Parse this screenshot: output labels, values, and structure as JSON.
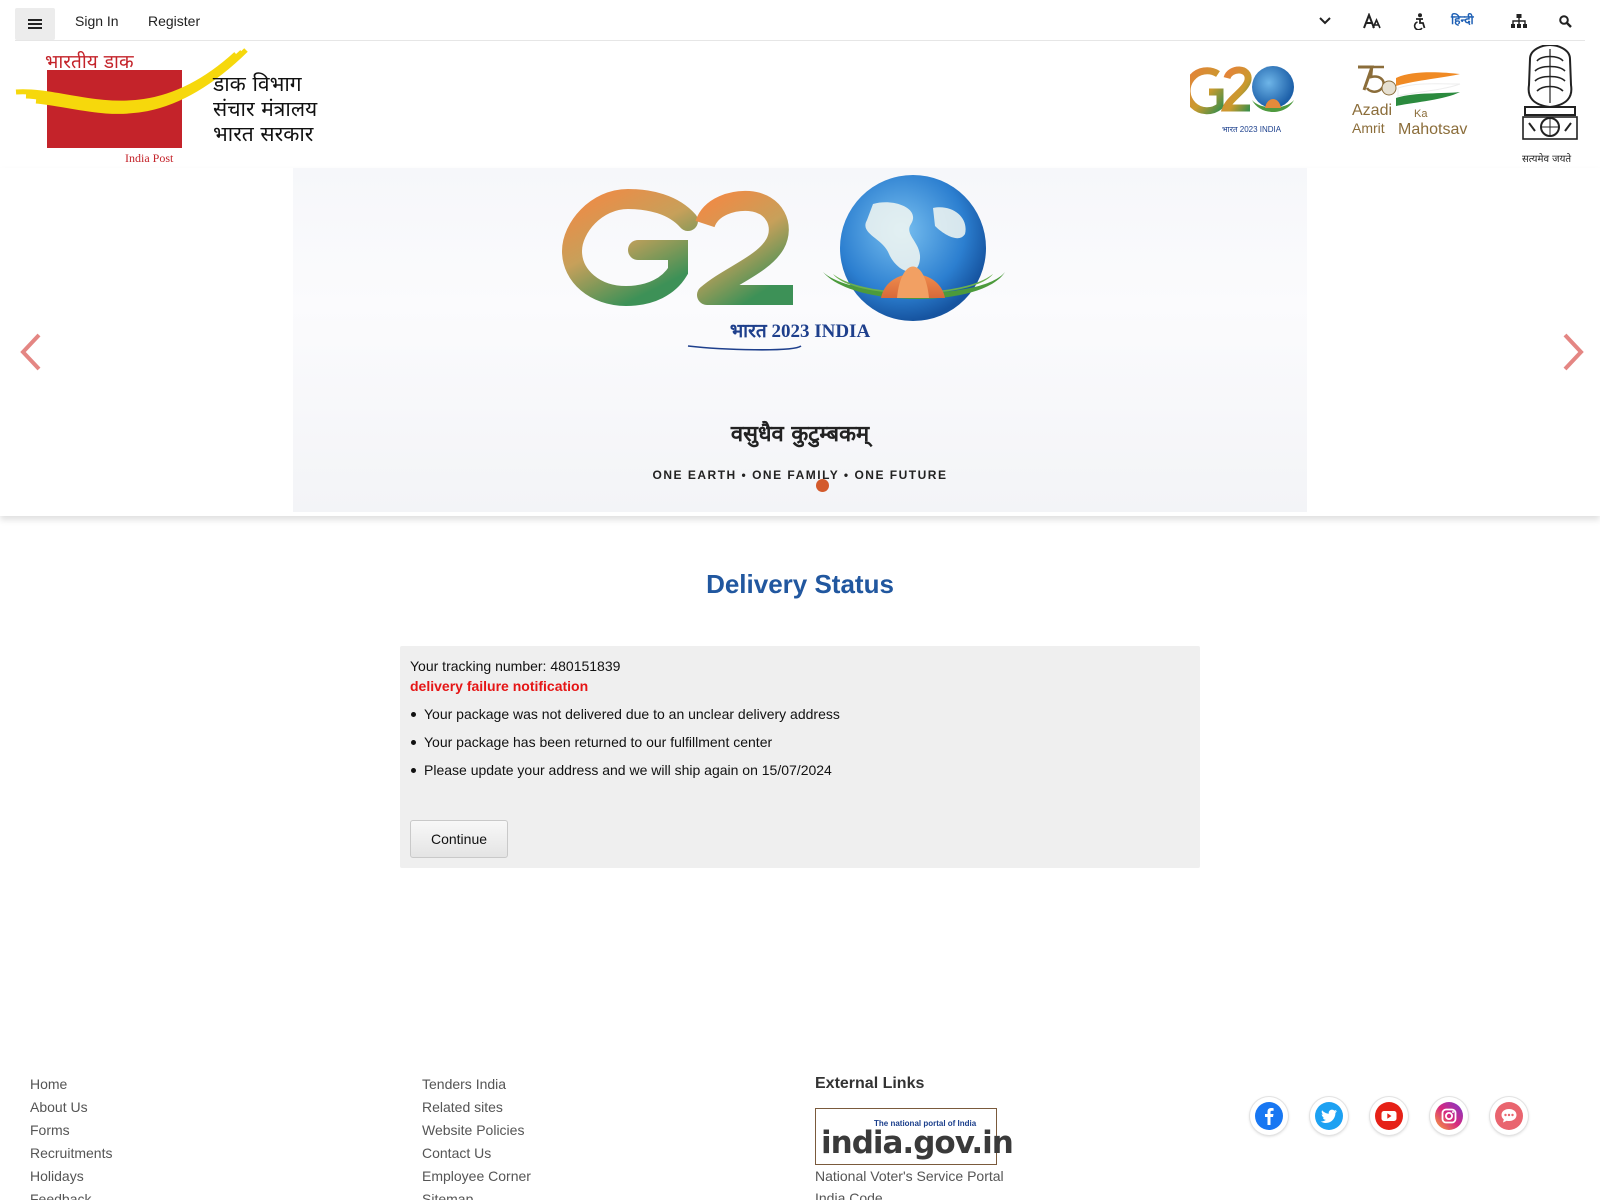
{
  "topbar": {
    "sign_in": "Sign In",
    "register": "Register",
    "hindi": "हिन्दी",
    "icons": [
      "menu-icon",
      "chevron-down-icon",
      "text-size-icon",
      "accessibility-icon",
      "sitemap-icon",
      "search-icon"
    ]
  },
  "header": {
    "logo_hindi": "भारतीय डाक",
    "logo_english": "India Post",
    "dept_line1": "डाक विभाग",
    "dept_line2": "संचार मंत्रालय",
    "dept_line3": "भारत सरकार",
    "g20_caption": "भारत 2023 INDIA",
    "azadi_line1": "Azadi",
    "azadi_ka": "Ka",
    "azadi_line2": "Amrit",
    "azadi_mahotsav": "Mahotsav",
    "emblem_caption": "सत्यमेव जयते"
  },
  "banner": {
    "g20_year": "भारत 2023 INDIA",
    "motto_hindi": "वसुधैव कुटुम्बकम्",
    "motto_english": "ONE EARTH • ONE FAMILY • ONE FUTURE"
  },
  "main": {
    "title": "Delivery Status",
    "tracking": "Your tracking number: 480151839",
    "failure": "delivery failure notification",
    "messages": [
      "Your package was not delivered due to an unclear delivery address",
      "Your package has been returned to our fulfillment center",
      "Please update your address and we will ship again on 15/07/2024"
    ],
    "continue_label": "Continue"
  },
  "footer": {
    "col1": [
      "Home",
      "About Us",
      "Forms",
      "Recruitments",
      "Holidays",
      "Feedback"
    ],
    "col2": [
      "Tenders India",
      "Related sites",
      "Website Policies",
      "Contact Us",
      "Employee Corner",
      "Sitemap"
    ],
    "external_title": "External Links",
    "indiagov_tag": "The national portal of India",
    "indiagov_text": "india.gov.in",
    "external_links": [
      "National Voter's Service Portal",
      "India Code"
    ],
    "social": [
      "facebook-icon",
      "twitter-icon",
      "youtube-icon",
      "instagram-icon",
      "chat-icon"
    ]
  },
  "colors": {
    "accent_blue": "#21579f",
    "india_post_red": "#c4232a",
    "failure_red": "#e51515"
  }
}
